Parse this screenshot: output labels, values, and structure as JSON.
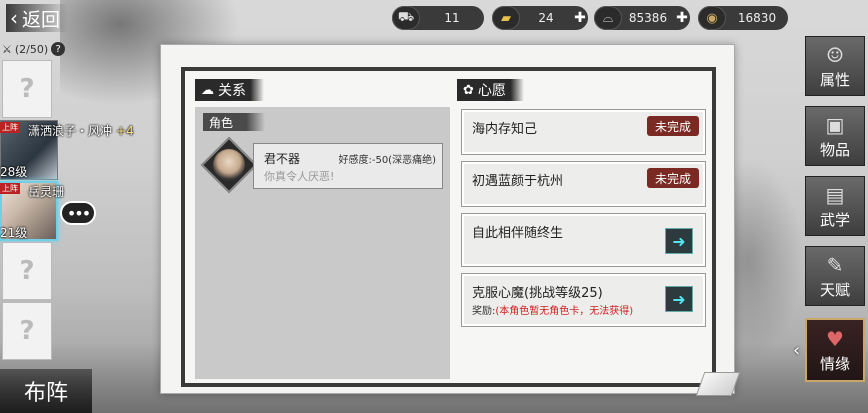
{
  "top_bar": {
    "back_label": "返回",
    "resources": [
      {
        "icon": "cart-icon",
        "value": "11",
        "has_plus": false
      },
      {
        "icon": "gold-ingot-icon",
        "value": "24",
        "has_plus": true
      },
      {
        "icon": "silver-ingot-icon",
        "value": "85386",
        "has_plus": true
      },
      {
        "icon": "coin-icon",
        "value": "16830",
        "has_plus": false
      }
    ]
  },
  "roster": {
    "count": "(2/50)",
    "help": "?",
    "empty_slot_mark": "?",
    "heroes": [
      {
        "tag": "上阵",
        "name": "潇洒浪子・风冲",
        "plus": "+4",
        "level": "28级",
        "active": false
      },
      {
        "tag": "上阵",
        "name": "岳灵珊",
        "plus": "",
        "level": "21级",
        "active": true
      }
    ],
    "chat_icon": "speech-bubble-icon",
    "formation_label": "布阵"
  },
  "relations": {
    "header": "关系",
    "role_label": "角色",
    "entries": [
      {
        "name": "君不器",
        "affinity": "好感度:-50(深恶痛绝)",
        "description": "你真令人厌恶!"
      }
    ]
  },
  "wishes": {
    "header": "心愿",
    "items": [
      {
        "title": "海内存知己",
        "status": "未完成",
        "reward_label": "",
        "reward_note": ""
      },
      {
        "title": "初遇蓝颜于杭州",
        "status": "未完成",
        "reward_label": "",
        "reward_note": ""
      },
      {
        "title": "自此相伴随终生",
        "status": "",
        "reward_label": "",
        "reward_note": ""
      },
      {
        "title": "克服心魔(挑战等级25)",
        "status": "",
        "reward_label": "奖励:",
        "reward_note": "(本角色暂无角色卡，无法获得)"
      }
    ]
  },
  "side_tabs": [
    {
      "label": "属性",
      "icon": "portrait-icon",
      "active": false
    },
    {
      "label": "物品",
      "icon": "box-icon",
      "active": false
    },
    {
      "label": "武学",
      "icon": "book-icon",
      "active": false
    },
    {
      "label": "天赋",
      "icon": "brush-icon",
      "active": false
    },
    {
      "label": "情缘",
      "icon": "heart-icon",
      "active": true
    }
  ],
  "colors": {
    "status_badge": "#7a2a22",
    "go_button": "#56e4f0",
    "active_highlight": "#6fd0e8"
  }
}
